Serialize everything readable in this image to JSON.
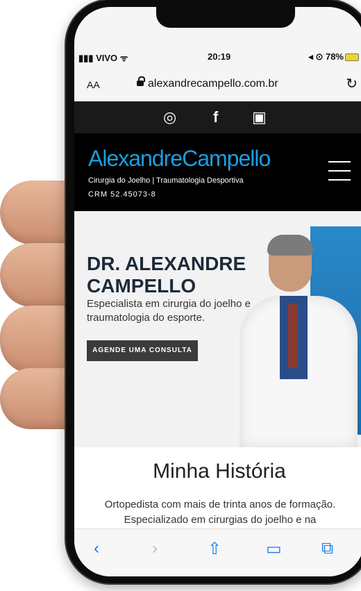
{
  "status_bar": {
    "carrier": "VIVO",
    "time": "20:19",
    "battery": "78%"
  },
  "browser": {
    "text_size_label": "AA",
    "url": "alexandrecampello.com.br"
  },
  "site": {
    "logo_text": "AlexandreCampello",
    "tagline": "Cirurgia do Joelho | Traumatologia Desportiva",
    "crm": "CRM 52.45073-8",
    "hero_name": "DR. ALEXANDRE CAMPELLO",
    "hero_specialty": "Especialista em cirurgia do joelho e traumatologia do esporte.",
    "cta_label": "AGENDE UMA CONSULTA",
    "section_title": "Minha História",
    "section_text_1": "Ortopedista com mais de trinta anos de formação.",
    "section_text_2": "Especializado em cirurgias do joelho e na"
  },
  "social_icons": [
    "whatsapp-icon",
    "facebook-icon",
    "instagram-icon"
  ],
  "toolbar_icons": [
    "back-icon",
    "forward-icon",
    "share-icon",
    "bookmarks-icon",
    "tabs-icon"
  ],
  "colors": {
    "brand_blue": "#1a9fe0",
    "link_blue": "#1c7af0",
    "header_black": "#000000"
  }
}
